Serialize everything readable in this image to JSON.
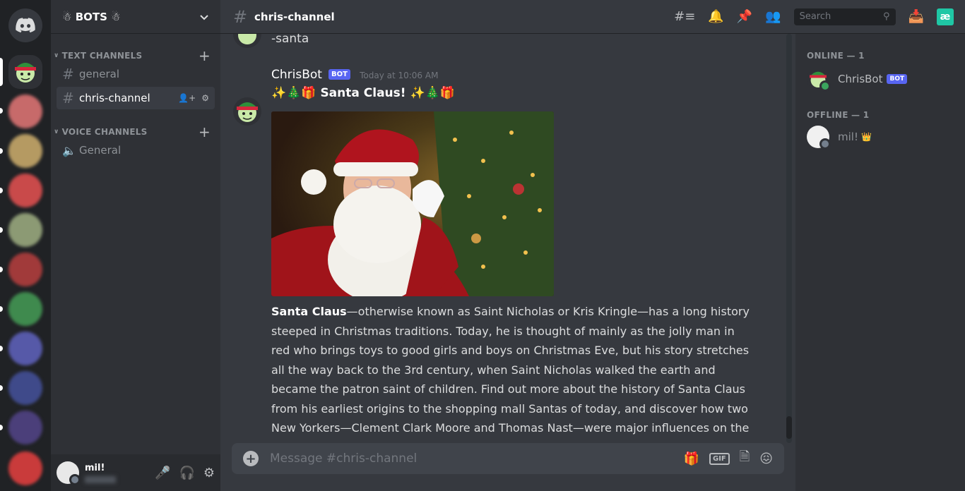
{
  "guild": {
    "name": "BOTS",
    "name_left_deco": "☃",
    "name_right_deco": "☃"
  },
  "sidebar": {
    "text_category": "TEXT CHANNELS",
    "voice_category": "VOICE CHANNELS",
    "text_channels": [
      {
        "label": "general"
      },
      {
        "label": "chris-channel"
      }
    ],
    "voice_channels": [
      {
        "label": "General"
      }
    ]
  },
  "user_panel": {
    "username": "mil!"
  },
  "topbar": {
    "channel_name": "chris-channel",
    "search_placeholder": "Search",
    "ext_badge": "æ"
  },
  "messages": {
    "prev_line": "-santa",
    "author": "ChrisBot",
    "bot_tag": "BOT",
    "timestamp": "Today at 10:06 AM",
    "headline": "✨🎄🎁 Santa Claus! ✨🎄🎁",
    "headline_emoji": "✨🎄🎁",
    "headline_text": "Santa Claus!",
    "body_bold": "Santa Claus",
    "body": "—otherwise known as Saint Nicholas or Kris Kringle—has a long history steeped in Christmas traditions. Today, he is thought of mainly as the jolly man in red who brings toys to good girls and boys on Christmas Eve, but his story stretches all the way back to the 3rd century, when Saint Nicholas walked the earth and became the patron saint of children. Find out more about the history of Santa Claus from his earliest origins to the shopping mall Santas of today, and discover how two New Yorkers—Clement Clark Moore and Thomas Nast—were major influences on the Santa Claus millions of children anticipate each Christmas."
  },
  "composer": {
    "placeholder": "Message #chris-channel",
    "gif_label": "GIF"
  },
  "members": {
    "online_header": "ONLINE — 1",
    "offline_header": "OFFLINE — 1",
    "online": [
      {
        "name": "ChrisBot",
        "tag": "BOT"
      }
    ],
    "offline": [
      {
        "name": "mil!",
        "badge": "👑"
      }
    ]
  },
  "colors": {
    "blurple": "#5865f2",
    "online": "#3ba55d",
    "offline": "#747f8d"
  }
}
